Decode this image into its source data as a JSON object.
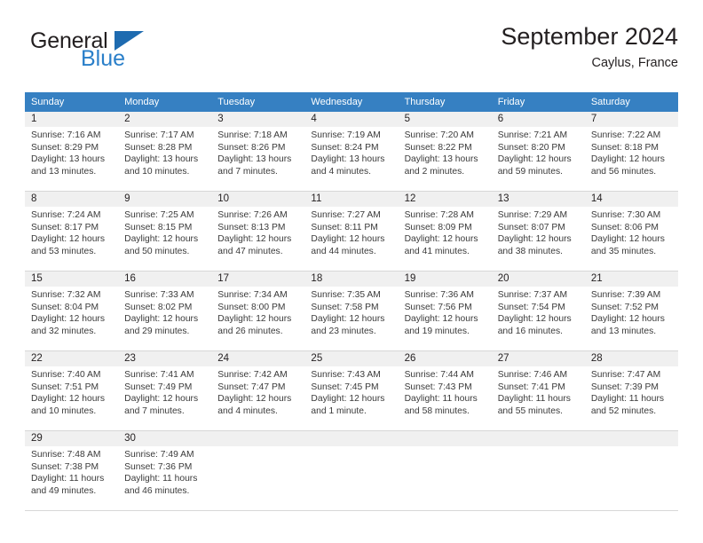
{
  "brand": {
    "line1": "General",
    "line2": "Blue",
    "triangle_icon": "triangle-icon",
    "accent_color": "#2a7fc9"
  },
  "header": {
    "title": "September 2024",
    "location": "Caylus, France"
  },
  "calendar": {
    "header_color": "#3680c2",
    "weekdays": [
      "Sunday",
      "Monday",
      "Tuesday",
      "Wednesday",
      "Thursday",
      "Friday",
      "Saturday"
    ],
    "weeks": [
      [
        {
          "day": "1",
          "sunrise": "Sunrise: 7:16 AM",
          "sunset": "Sunset: 8:29 PM",
          "daylight1": "Daylight: 13 hours",
          "daylight2": "and 13 minutes."
        },
        {
          "day": "2",
          "sunrise": "Sunrise: 7:17 AM",
          "sunset": "Sunset: 8:28 PM",
          "daylight1": "Daylight: 13 hours",
          "daylight2": "and 10 minutes."
        },
        {
          "day": "3",
          "sunrise": "Sunrise: 7:18 AM",
          "sunset": "Sunset: 8:26 PM",
          "daylight1": "Daylight: 13 hours",
          "daylight2": "and 7 minutes."
        },
        {
          "day": "4",
          "sunrise": "Sunrise: 7:19 AM",
          "sunset": "Sunset: 8:24 PM",
          "daylight1": "Daylight: 13 hours",
          "daylight2": "and 4 minutes."
        },
        {
          "day": "5",
          "sunrise": "Sunrise: 7:20 AM",
          "sunset": "Sunset: 8:22 PM",
          "daylight1": "Daylight: 13 hours",
          "daylight2": "and 2 minutes."
        },
        {
          "day": "6",
          "sunrise": "Sunrise: 7:21 AM",
          "sunset": "Sunset: 8:20 PM",
          "daylight1": "Daylight: 12 hours",
          "daylight2": "and 59 minutes."
        },
        {
          "day": "7",
          "sunrise": "Sunrise: 7:22 AM",
          "sunset": "Sunset: 8:18 PM",
          "daylight1": "Daylight: 12 hours",
          "daylight2": "and 56 minutes."
        }
      ],
      [
        {
          "day": "8",
          "sunrise": "Sunrise: 7:24 AM",
          "sunset": "Sunset: 8:17 PM",
          "daylight1": "Daylight: 12 hours",
          "daylight2": "and 53 minutes."
        },
        {
          "day": "9",
          "sunrise": "Sunrise: 7:25 AM",
          "sunset": "Sunset: 8:15 PM",
          "daylight1": "Daylight: 12 hours",
          "daylight2": "and 50 minutes."
        },
        {
          "day": "10",
          "sunrise": "Sunrise: 7:26 AM",
          "sunset": "Sunset: 8:13 PM",
          "daylight1": "Daylight: 12 hours",
          "daylight2": "and 47 minutes."
        },
        {
          "day": "11",
          "sunrise": "Sunrise: 7:27 AM",
          "sunset": "Sunset: 8:11 PM",
          "daylight1": "Daylight: 12 hours",
          "daylight2": "and 44 minutes."
        },
        {
          "day": "12",
          "sunrise": "Sunrise: 7:28 AM",
          "sunset": "Sunset: 8:09 PM",
          "daylight1": "Daylight: 12 hours",
          "daylight2": "and 41 minutes."
        },
        {
          "day": "13",
          "sunrise": "Sunrise: 7:29 AM",
          "sunset": "Sunset: 8:07 PM",
          "daylight1": "Daylight: 12 hours",
          "daylight2": "and 38 minutes."
        },
        {
          "day": "14",
          "sunrise": "Sunrise: 7:30 AM",
          "sunset": "Sunset: 8:06 PM",
          "daylight1": "Daylight: 12 hours",
          "daylight2": "and 35 minutes."
        }
      ],
      [
        {
          "day": "15",
          "sunrise": "Sunrise: 7:32 AM",
          "sunset": "Sunset: 8:04 PM",
          "daylight1": "Daylight: 12 hours",
          "daylight2": "and 32 minutes."
        },
        {
          "day": "16",
          "sunrise": "Sunrise: 7:33 AM",
          "sunset": "Sunset: 8:02 PM",
          "daylight1": "Daylight: 12 hours",
          "daylight2": "and 29 minutes."
        },
        {
          "day": "17",
          "sunrise": "Sunrise: 7:34 AM",
          "sunset": "Sunset: 8:00 PM",
          "daylight1": "Daylight: 12 hours",
          "daylight2": "and 26 minutes."
        },
        {
          "day": "18",
          "sunrise": "Sunrise: 7:35 AM",
          "sunset": "Sunset: 7:58 PM",
          "daylight1": "Daylight: 12 hours",
          "daylight2": "and 23 minutes."
        },
        {
          "day": "19",
          "sunrise": "Sunrise: 7:36 AM",
          "sunset": "Sunset: 7:56 PM",
          "daylight1": "Daylight: 12 hours",
          "daylight2": "and 19 minutes."
        },
        {
          "day": "20",
          "sunrise": "Sunrise: 7:37 AM",
          "sunset": "Sunset: 7:54 PM",
          "daylight1": "Daylight: 12 hours",
          "daylight2": "and 16 minutes."
        },
        {
          "day": "21",
          "sunrise": "Sunrise: 7:39 AM",
          "sunset": "Sunset: 7:52 PM",
          "daylight1": "Daylight: 12 hours",
          "daylight2": "and 13 minutes."
        }
      ],
      [
        {
          "day": "22",
          "sunrise": "Sunrise: 7:40 AM",
          "sunset": "Sunset: 7:51 PM",
          "daylight1": "Daylight: 12 hours",
          "daylight2": "and 10 minutes."
        },
        {
          "day": "23",
          "sunrise": "Sunrise: 7:41 AM",
          "sunset": "Sunset: 7:49 PM",
          "daylight1": "Daylight: 12 hours",
          "daylight2": "and 7 minutes."
        },
        {
          "day": "24",
          "sunrise": "Sunrise: 7:42 AM",
          "sunset": "Sunset: 7:47 PM",
          "daylight1": "Daylight: 12 hours",
          "daylight2": "and 4 minutes."
        },
        {
          "day": "25",
          "sunrise": "Sunrise: 7:43 AM",
          "sunset": "Sunset: 7:45 PM",
          "daylight1": "Daylight: 12 hours",
          "daylight2": "and 1 minute."
        },
        {
          "day": "26",
          "sunrise": "Sunrise: 7:44 AM",
          "sunset": "Sunset: 7:43 PM",
          "daylight1": "Daylight: 11 hours",
          "daylight2": "and 58 minutes."
        },
        {
          "day": "27",
          "sunrise": "Sunrise: 7:46 AM",
          "sunset": "Sunset: 7:41 PM",
          "daylight1": "Daylight: 11 hours",
          "daylight2": "and 55 minutes."
        },
        {
          "day": "28",
          "sunrise": "Sunrise: 7:47 AM",
          "sunset": "Sunset: 7:39 PM",
          "daylight1": "Daylight: 11 hours",
          "daylight2": "and 52 minutes."
        }
      ],
      [
        {
          "day": "29",
          "sunrise": "Sunrise: 7:48 AM",
          "sunset": "Sunset: 7:38 PM",
          "daylight1": "Daylight: 11 hours",
          "daylight2": "and 49 minutes."
        },
        {
          "day": "30",
          "sunrise": "Sunrise: 7:49 AM",
          "sunset": "Sunset: 7:36 PM",
          "daylight1": "Daylight: 11 hours",
          "daylight2": "and 46 minutes."
        },
        {
          "day": "",
          "sunrise": "",
          "sunset": "",
          "daylight1": "",
          "daylight2": ""
        },
        {
          "day": "",
          "sunrise": "",
          "sunset": "",
          "daylight1": "",
          "daylight2": ""
        },
        {
          "day": "",
          "sunrise": "",
          "sunset": "",
          "daylight1": "",
          "daylight2": ""
        },
        {
          "day": "",
          "sunrise": "",
          "sunset": "",
          "daylight1": "",
          "daylight2": ""
        },
        {
          "day": "",
          "sunrise": "",
          "sunset": "",
          "daylight1": "",
          "daylight2": ""
        }
      ]
    ]
  }
}
